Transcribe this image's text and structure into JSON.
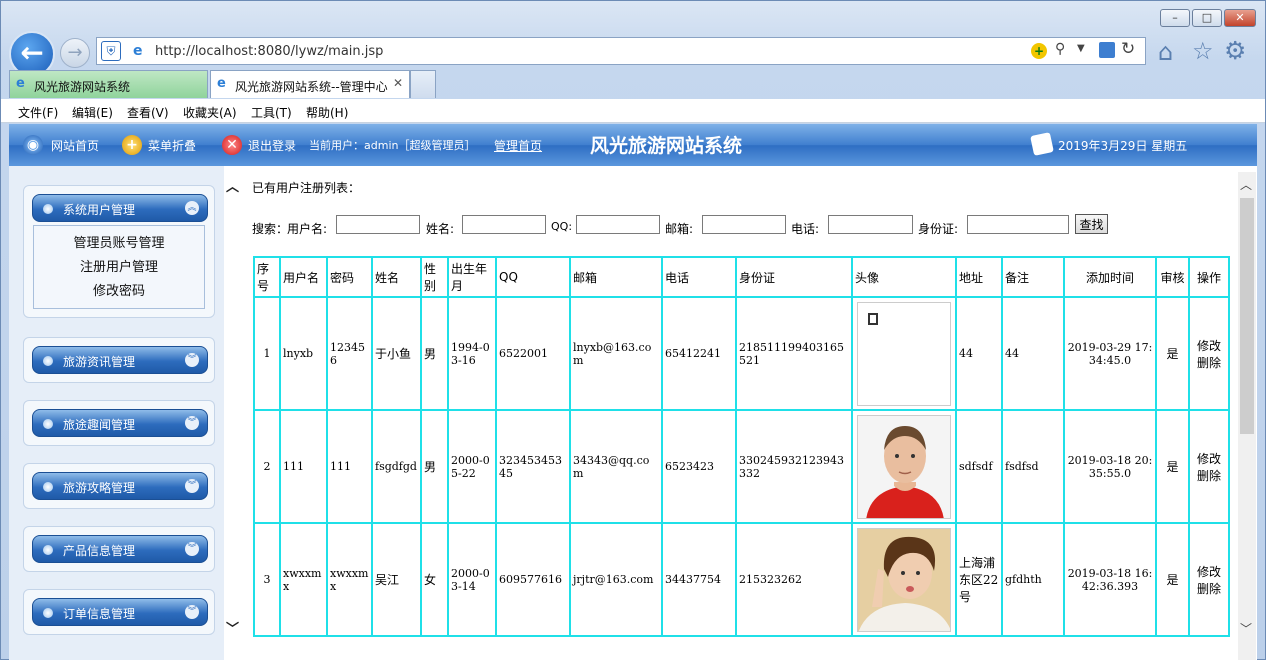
{
  "browser": {
    "url": "http://localhost:8080/lywz/main.jsp",
    "tabs": [
      {
        "label": "风光旅游网站系统"
      },
      {
        "label": "风光旅游网站系统--管理中心"
      }
    ],
    "menu": [
      "文件(F)",
      "编辑(E)",
      "查看(V)",
      "收藏夹(A)",
      "工具(T)",
      "帮助(H)"
    ],
    "win_buttons": [
      "–",
      "□",
      "✕"
    ]
  },
  "topbar": {
    "home": "网站首页",
    "collapse": "菜单折叠",
    "logout": "退出登录",
    "current_user": "当前用户：admin［超级管理员］",
    "admin_home": "管理首页",
    "site_title": "风光旅游网站系统",
    "date": "2019年3月29日 星期五"
  },
  "sidebar": {
    "groups": [
      {
        "label": "系统用户管理",
        "items": [
          "管理员账号管理",
          "注册用户管理",
          "修改密码"
        ]
      },
      {
        "label": "旅游资讯管理"
      },
      {
        "label": "旅途趣闻管理"
      },
      {
        "label": "旅游攻略管理"
      },
      {
        "label": "产品信息管理"
      },
      {
        "label": "订单信息管理"
      }
    ]
  },
  "main": {
    "heading": "已有用户注册列表：",
    "search": {
      "label": "搜索：",
      "fields": [
        "用户名:",
        "姓名:",
        "QQ:",
        "邮箱:",
        "电话:",
        "身份证:"
      ],
      "button": "查找"
    },
    "columns": [
      "序号",
      "用户名",
      "密码",
      "姓名",
      "性别",
      "出生年月",
      "QQ",
      "邮箱",
      "电话",
      "身份证",
      "头像",
      "地址",
      "备注",
      "添加时间",
      "审核",
      "操作"
    ],
    "rows": [
      {
        "no": "1",
        "username": "lnyxb",
        "password": "123456",
        "name": "于小鱼",
        "gender": "男",
        "birth": "1994-03-16",
        "qq": "6522001",
        "email": "lnyxb@163.com",
        "phone": "65412241",
        "idcard": "218511199403165521",
        "address": "44",
        "note": "44",
        "added": "2019-03-29 17:34:45.0",
        "audit": "是",
        "edit": "修改",
        "delete": "删除"
      },
      {
        "no": "2",
        "username": "111",
        "password": "111",
        "name": "fsgdfgd",
        "gender": "男",
        "birth": "2000-05-22",
        "qq": "32345345345",
        "email": "34343@qq.com",
        "phone": "6523423",
        "idcard": "330245932123943332",
        "address": "sdfsdf",
        "note": "fsdfsd",
        "added": "2019-03-18 20:35:55.0",
        "audit": "是",
        "edit": "修改",
        "delete": "删除"
      },
      {
        "no": "3",
        "username": "xwxxmx",
        "password": "xwxxmx",
        "name": "吴江",
        "gender": "女",
        "birth": "2000-03-14",
        "qq": "609577616",
        "email": "jrjtr@163.com",
        "phone": "34437754",
        "idcard": "215323262",
        "address": "上海浦东区22号",
        "note": "gfdhth",
        "added": "2019-03-18 16:42:36.393",
        "audit": "是",
        "edit": "修改",
        "delete": "删除"
      }
    ]
  }
}
